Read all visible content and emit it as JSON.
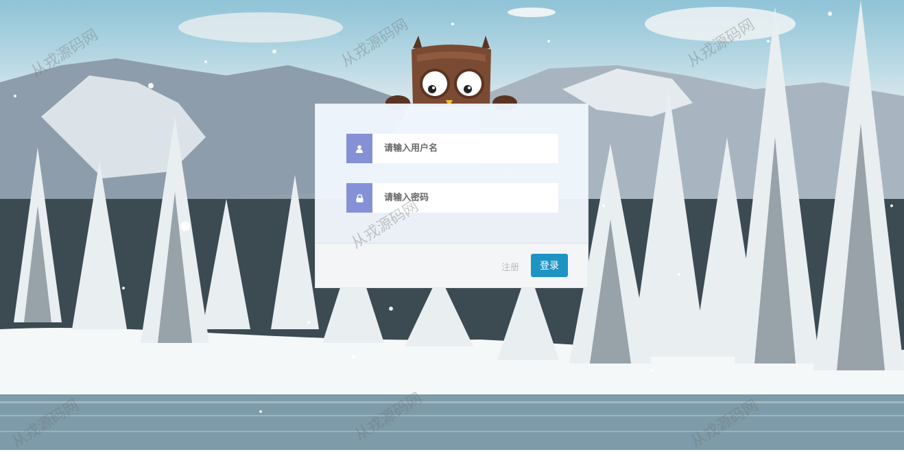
{
  "watermark_text": "从戎源码网",
  "login": {
    "username_placeholder": "请输入用户名",
    "password_placeholder": "请输入密码",
    "username_icon": "user-icon",
    "password_icon": "lock-icon",
    "register_label": "注册",
    "login_label": "登录"
  },
  "colors": {
    "icon_bg": "#8591d6",
    "button_bg": "#1e94c4",
    "owl_body": "#7b4a32"
  }
}
